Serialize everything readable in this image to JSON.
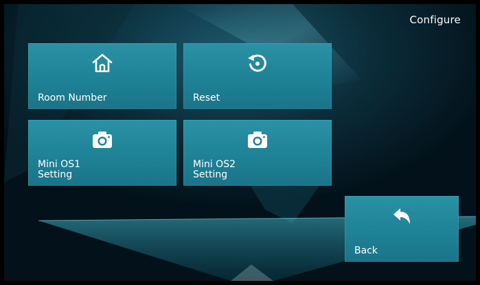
{
  "header": {
    "title": "Configure"
  },
  "tiles": [
    {
      "id": "room-number",
      "label": "Room Number",
      "icon": "home-icon"
    },
    {
      "id": "reset",
      "label": "Reset",
      "icon": "reset-icon"
    },
    {
      "id": "mini-os1",
      "label_line1": "Mini OS1",
      "label_line2": "Setting",
      "icon": "camera-icon"
    },
    {
      "id": "mini-os2",
      "label_line1": "Mini OS2",
      "label_line2": "Setting",
      "icon": "camera-icon"
    }
  ],
  "back": {
    "label": "Back",
    "icon": "back-arrow-icon"
  },
  "colors": {
    "tile": "#2a92a6",
    "background": "#020c12",
    "text": "#ffffff"
  }
}
